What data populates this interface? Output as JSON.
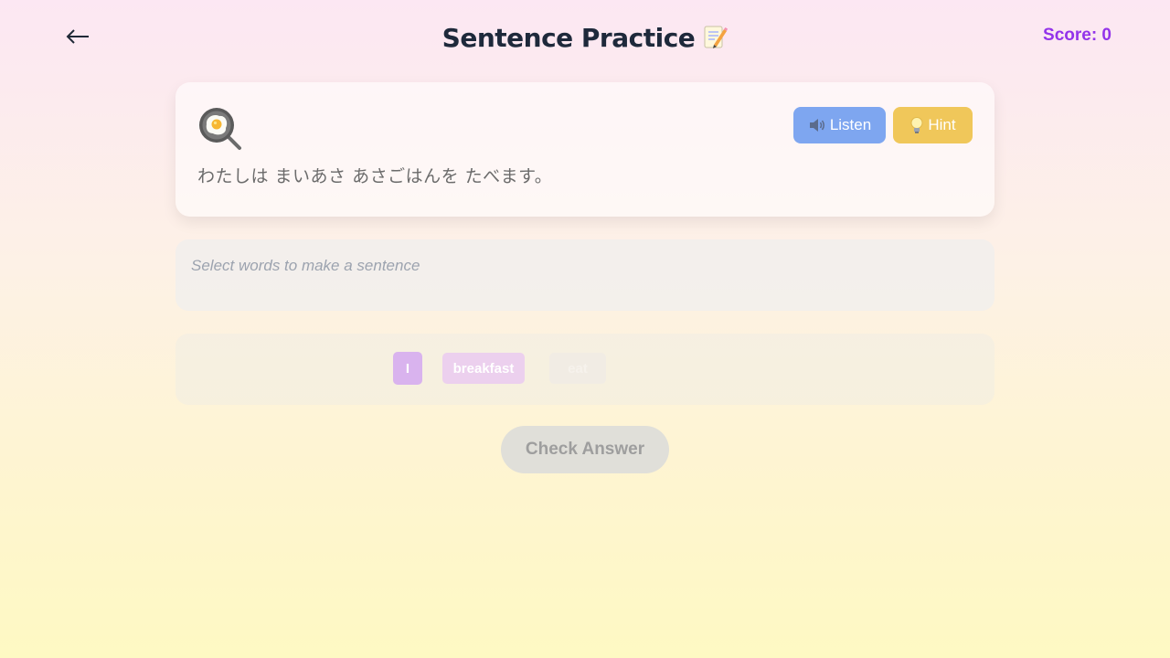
{
  "header": {
    "back_icon": "arrow-left-icon",
    "title": "Sentence Practice",
    "title_icon": "memo-pencil-icon",
    "score": "Score: 0"
  },
  "prompt": {
    "image_icon": "frying-pan-egg-icon",
    "listen_label": "Listen",
    "listen_icon": "speaker-icon",
    "hint_label": "Hint",
    "hint_icon": "lightbulb-icon",
    "sentence": "わたしは まいあさ あさごはんを たべます。"
  },
  "answer": {
    "placeholder": "Select words to make a sentence"
  },
  "word_bank": {
    "chips": [
      "I",
      "breakfast",
      "eat"
    ]
  },
  "actions": {
    "check_label": "Check Answer"
  },
  "colors": {
    "accent_purple": "#9333ea",
    "listen_blue": "#7ea6f0",
    "hint_yellow": "#f0c75a",
    "title_dark": "#1e293b"
  }
}
